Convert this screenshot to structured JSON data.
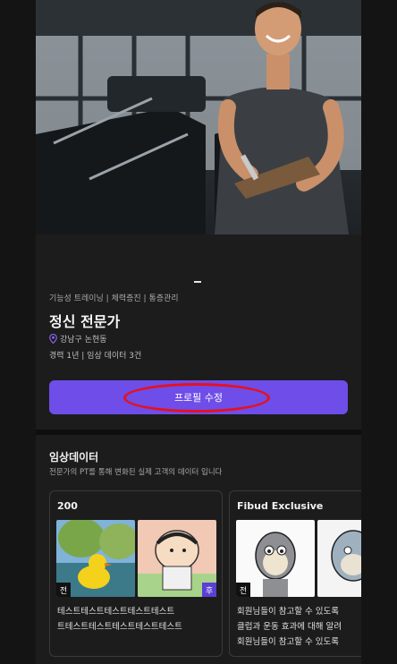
{
  "profile": {
    "tags": "기능성 트레이닝 | 체력증진 | 통증관리",
    "name": "정신 전문가",
    "location": "강남구 논현동",
    "career": "경력 1년 | 임상 데이터 3건",
    "edit_label": "프로필 수정"
  },
  "clinical": {
    "title": "임상데이터",
    "subtitle": "전문가의 PT를 통해 변화된 실제 고객의 데이터 입니다",
    "cards": [
      {
        "title": "200",
        "before_badge": "전",
        "after_badge": "후",
        "text_line1": "테스트테스트테스트테스트테스트",
        "text_line2": "트테스트테스트테스트테스트테스트"
      },
      {
        "title": "Fibud Exclusive",
        "before_badge": "전",
        "text_line1": "회원님들이 참고할 수 있도록",
        "text_line2": "클럽과 운동 효과에 대해 알려",
        "text_line3": "회원님들이 참고할 수 있도록"
      }
    ]
  },
  "colors": {
    "accent": "#6e4de8",
    "background": "#1c1c1c",
    "annotation": "#e8101a"
  }
}
